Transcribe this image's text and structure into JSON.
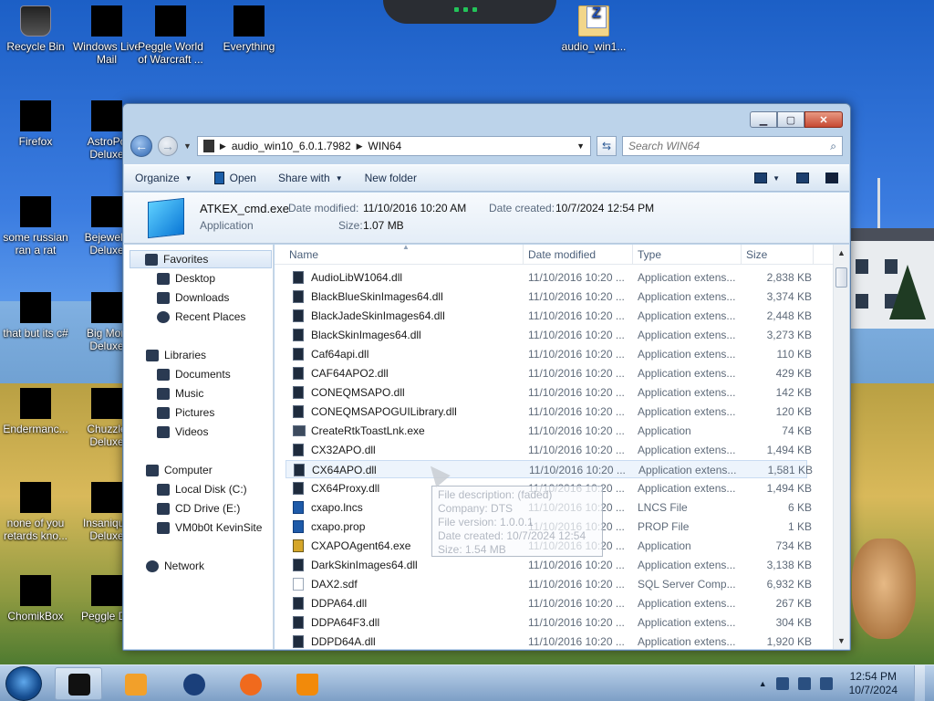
{
  "desktop": {
    "icons": [
      {
        "label": "Recycle Bin",
        "style": "bin"
      },
      {
        "label": "Windows Live Mail",
        "style": "black"
      },
      {
        "label": "Peggle World of Warcraft ...",
        "style": "black"
      },
      {
        "label": "Everything",
        "style": "black"
      },
      {
        "label": "audio_win1...",
        "style": "zip"
      },
      {
        "label": "Firefox",
        "style": "black"
      },
      {
        "label": "AstroPo Deluxe",
        "style": "black"
      },
      {
        "label": "some russian ran a rat",
        "style": "black"
      },
      {
        "label": "Bejewele Deluxe",
        "style": "black"
      },
      {
        "label": "that but its c#",
        "style": "black"
      },
      {
        "label": "Big Mon Deluxe",
        "style": "black"
      },
      {
        "label": "Endermanc...",
        "style": "black"
      },
      {
        "label": "Chuzzle Deluxe",
        "style": "black"
      },
      {
        "label": "none of you retards kno...",
        "style": "black"
      },
      {
        "label": "Insaniqua Deluxe",
        "style": "black"
      },
      {
        "label": "ChomikBox",
        "style": "black"
      },
      {
        "label": "Peggle De",
        "style": "black"
      }
    ]
  },
  "explorer": {
    "breadcrumb": [
      "audio_win10_6.0.1.7982",
      "WIN64"
    ],
    "search_placeholder": "Search WIN64",
    "toolbar": {
      "organize": "Organize",
      "open": "Open",
      "share_with": "Share with",
      "new_folder": "New folder"
    },
    "details": {
      "name": "ATKEX_cmd.exe",
      "type": "Application",
      "date_modified_label": "Date modified:",
      "date_modified": "11/10/2016 10:20 AM",
      "size_label": "Size:",
      "size": "1.07 MB",
      "date_created_label": "Date created:",
      "date_created": "10/7/2024 12:54 PM"
    },
    "nav": {
      "favorites": "Favorites",
      "desktop": "Desktop",
      "downloads": "Downloads",
      "recent_places": "Recent Places",
      "libraries": "Libraries",
      "documents": "Documents",
      "music": "Music",
      "pictures": "Pictures",
      "videos": "Videos",
      "computer": "Computer",
      "local_disk": "Local Disk (C:)",
      "cd_drive": "CD Drive (E:)",
      "vm": "VM0b0t KevinSite",
      "network": "Network"
    },
    "columns": {
      "name": "Name",
      "date_modified": "Date modified",
      "type": "Type",
      "size": "Size"
    },
    "files": [
      {
        "name": "AudioLibW1064.dll",
        "date": "11/10/2016 10:20 ...",
        "type": "Application extens...",
        "size": "2,838 KB",
        "icon": "dll"
      },
      {
        "name": "BlackBlueSkinImages64.dll",
        "date": "11/10/2016 10:20 ...",
        "type": "Application extens...",
        "size": "3,374 KB",
        "icon": "dll"
      },
      {
        "name": "BlackJadeSkinImages64.dll",
        "date": "11/10/2016 10:20 ...",
        "type": "Application extens...",
        "size": "2,448 KB",
        "icon": "dll"
      },
      {
        "name": "BlackSkinImages64.dll",
        "date": "11/10/2016 10:20 ...",
        "type": "Application extens...",
        "size": "3,273 KB",
        "icon": "dll"
      },
      {
        "name": "Caf64api.dll",
        "date": "11/10/2016 10:20 ...",
        "type": "Application extens...",
        "size": "110 KB",
        "icon": "dll"
      },
      {
        "name": "CAF64APO2.dll",
        "date": "11/10/2016 10:20 ...",
        "type": "Application extens...",
        "size": "429 KB",
        "icon": "dll"
      },
      {
        "name": "CONEQMSAPO.dll",
        "date": "11/10/2016 10:20 ...",
        "type": "Application extens...",
        "size": "142 KB",
        "icon": "dll"
      },
      {
        "name": "CONEQMSAPOGUILibrary.dll",
        "date": "11/10/2016 10:20 ...",
        "type": "Application extens...",
        "size": "120 KB",
        "icon": "dll"
      },
      {
        "name": "CreateRtkToastLnk.exe",
        "date": "11/10/2016 10:20 ...",
        "type": "Application",
        "size": "74 KB",
        "icon": "exe"
      },
      {
        "name": "CX32APO.dll",
        "date": "11/10/2016 10:20 ...",
        "type": "Application extens...",
        "size": "1,494 KB",
        "icon": "dll"
      },
      {
        "name": "CX64APO.dll",
        "date": "11/10/2016 10:20 ...",
        "type": "Application extens...",
        "size": "1,581 KB",
        "icon": "dll",
        "hover": true
      },
      {
        "name": "CX64Proxy.dll",
        "date": "11/10/2016 10:20 ...",
        "type": "Application extens...",
        "size": "1,494 KB",
        "icon": "dll"
      },
      {
        "name": "cxapo.lncs",
        "date": "11/10/2016 10:20 ...",
        "type": "LNCS File",
        "size": "6 KB",
        "icon": "doc"
      },
      {
        "name": "cxapo.prop",
        "date": "11/10/2016 10:20 ...",
        "type": "PROP File",
        "size": "1 KB",
        "icon": "doc"
      },
      {
        "name": "CXAPOAgent64.exe",
        "date": "11/10/2016 10:20 ...",
        "type": "Application",
        "size": "734 KB",
        "icon": "agent"
      },
      {
        "name": "DarkSkinImages64.dll",
        "date": "11/10/2016 10:20 ...",
        "type": "Application extens...",
        "size": "3,138 KB",
        "icon": "dll"
      },
      {
        "name": "DAX2.sdf",
        "date": "11/10/2016 10:20 ...",
        "type": "SQL Server Comp...",
        "size": "6,932 KB",
        "icon": "sdf"
      },
      {
        "name": "DDPA64.dll",
        "date": "11/10/2016 10:20 ...",
        "type": "Application extens...",
        "size": "267 KB",
        "icon": "dll"
      },
      {
        "name": "DDPA64F3.dll",
        "date": "11/10/2016 10:20 ...",
        "type": "Application extens...",
        "size": "304 KB",
        "icon": "dll"
      },
      {
        "name": "DDPD64A.dll",
        "date": "11/10/2016 10:20 ...",
        "type": "Application extens...",
        "size": "1,920 KB",
        "icon": "dll"
      }
    ],
    "tooltip": [
      "File description: (faded)",
      "Company: DTS",
      "File version: 1.0.0.1",
      "Date created: 10/7/2024 12:54",
      "Size: 1.54 MB"
    ]
  },
  "taskbar": {
    "time": "12:54 PM",
    "date": "10/7/2024"
  }
}
